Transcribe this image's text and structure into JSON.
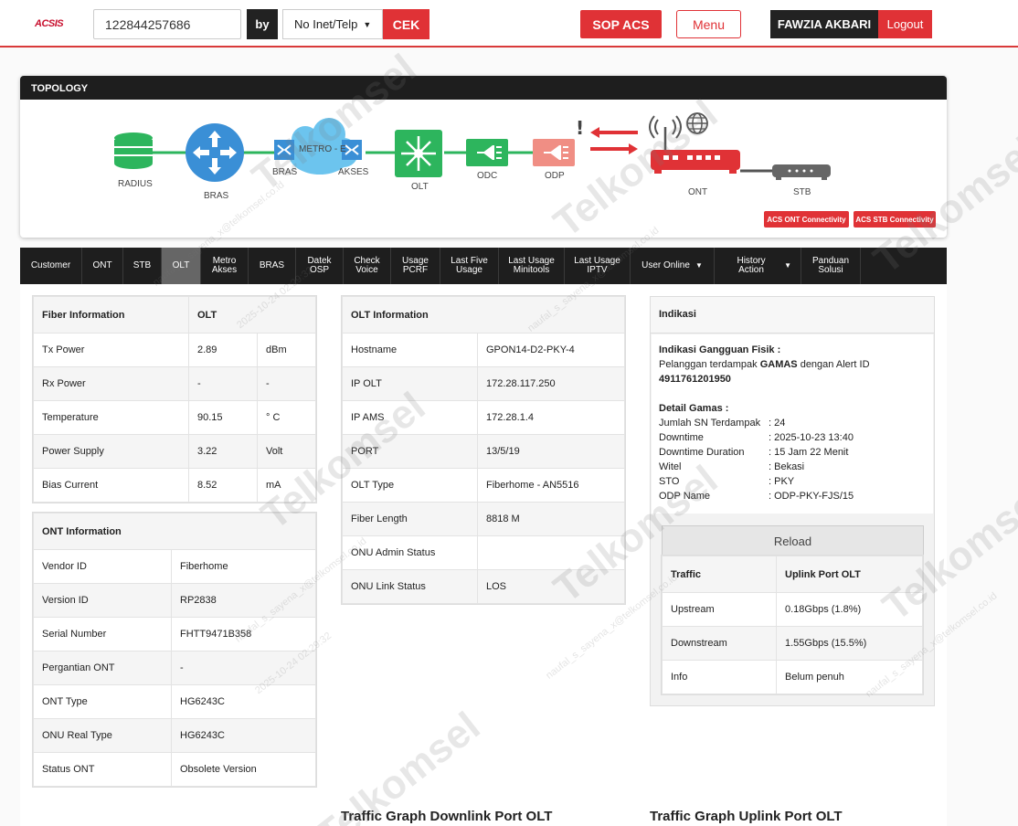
{
  "header": {
    "logo": "ACSIS",
    "search_value": "122844257686",
    "by_label": "by",
    "search_type": "No Inet/Telp",
    "cek_label": "CEK",
    "sop_label": "SOP ACS",
    "menu_label": "Menu",
    "user_name": "FAWZIA AKBARI",
    "logout_label": "Logout"
  },
  "topology": {
    "title": "TOPOLOGY",
    "nodes": {
      "radius": "RADIUS",
      "bras": "BRAS",
      "bras2": "BRAS",
      "metro": "METRO - E",
      "akses": "AKSES",
      "olt": "OLT",
      "odc": "ODC",
      "odp": "ODP",
      "ont": "ONT",
      "stb": "STB"
    },
    "acs_ont_label": "ACS ONT Connectivity",
    "acs_stb_label": "ACS STB Connectivity",
    "colors": {
      "green": "#2db55d",
      "blue": "#3a8fd6",
      "red": "#e03236",
      "gray": "#555555"
    }
  },
  "tabs": [
    {
      "label": "Customer"
    },
    {
      "label": "ONT"
    },
    {
      "label": "STB"
    },
    {
      "label": "OLT"
    },
    {
      "label": "Metro\nAkses"
    },
    {
      "label": "BRAS"
    },
    {
      "label": "Datek\nOSP"
    },
    {
      "label": "Check\nVoice"
    },
    {
      "label": "Usage\nPCRF"
    },
    {
      "label": "Last Five\nUsage"
    },
    {
      "label": "Last Usage\nMinitools"
    },
    {
      "label": "Last Usage\nIPTV"
    },
    {
      "label": "User Online"
    },
    {
      "label": "History Action"
    },
    {
      "label": "Panduan\nSolusi"
    }
  ],
  "fiber": {
    "header": [
      "Fiber Information",
      "OLT",
      ""
    ],
    "rows": [
      [
        "Tx Power",
        "2.89",
        "dBm"
      ],
      [
        "Rx Power",
        "-",
        "-"
      ],
      [
        "Temperature",
        "90.15",
        "° C"
      ],
      [
        "Power Supply",
        "3.22",
        "Volt"
      ],
      [
        "Bias Current",
        "8.52",
        "mA"
      ]
    ]
  },
  "ont": {
    "header": "ONT Information",
    "rows": [
      [
        "Vendor ID",
        "Fiberhome"
      ],
      [
        "Version ID",
        "RP2838"
      ],
      [
        "Serial Number",
        "FHTT9471B358"
      ],
      [
        "Pergantian ONT",
        "-"
      ],
      [
        "ONT Type",
        "HG6243C"
      ],
      [
        "ONU Real Type",
        "HG6243C"
      ],
      [
        "Status ONT",
        "Obsolete Version"
      ]
    ]
  },
  "olt": {
    "header": "OLT Information",
    "rows": [
      [
        "Hostname",
        "GPON14-D2-PKY-4"
      ],
      [
        "IP OLT",
        "172.28.117.250"
      ],
      [
        "IP AMS",
        "172.28.1.4"
      ],
      [
        "PORT",
        "13/5/19"
      ],
      [
        "OLT Type",
        "Fiberhome - AN5516"
      ],
      [
        "Fiber Length",
        "8818 M"
      ],
      [
        "ONU Admin Status",
        ""
      ],
      [
        "ONU Link Status",
        "LOS"
      ]
    ]
  },
  "indikasi": {
    "title": "Indikasi",
    "gangguan_title": "Indikasi Gangguan Fisik :",
    "gangguan_pre": "Pelanggan terdampak ",
    "gangguan_bold": "GAMAS",
    "gangguan_post": " dengan Alert ID",
    "alert_id": "4911761201950",
    "detail_title": "Detail Gamas :",
    "details": [
      [
        "Jumlah SN Terdampak",
        ": 24"
      ],
      [
        "Downtime",
        ": 2025-10-23 13:40"
      ],
      [
        "Downtime Duration",
        ": 15 Jam 22 Menit"
      ],
      [
        "Witel",
        ": Bekasi"
      ],
      [
        "STO",
        ": PKY"
      ],
      [
        "ODP Name",
        ": ODP-PKY-FJS/15"
      ]
    ],
    "reload_label": "Reload",
    "traffic_header": [
      "Traffic",
      "Uplink Port OLT"
    ],
    "traffic_rows": [
      [
        "Upstream",
        "0.18Gbps (1.8%)"
      ],
      [
        "Downstream",
        "1.55Gbps (15.5%)"
      ],
      [
        "Info",
        "Belum penuh"
      ]
    ]
  },
  "graphs": {
    "downlink_title": "Traffic Graph Downlink Port OLT",
    "uplink_title": "Traffic Graph Uplink Port OLT"
  },
  "watermark": {
    "brand": "Telkomsel",
    "email": "naufal_s_sayena_x@telkomsel.co.id",
    "stamp": "2025-10-24 02:29:32"
  }
}
